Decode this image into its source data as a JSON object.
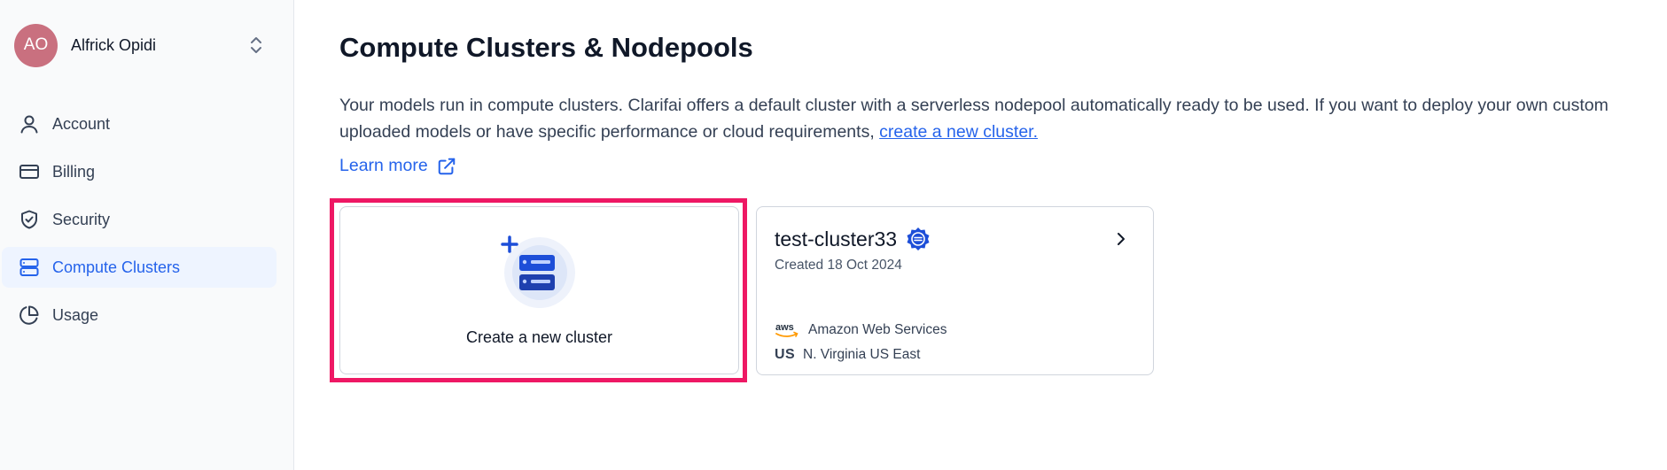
{
  "sidebar": {
    "user": {
      "initials": "AO",
      "name": "Alfrick Opidi",
      "avatar_color": "#c9707f"
    },
    "items": [
      {
        "label": "Account",
        "icon": "user-icon",
        "active": false
      },
      {
        "label": "Billing",
        "icon": "credit-card-icon",
        "active": false
      },
      {
        "label": "Security",
        "icon": "shield-check-icon",
        "active": false
      },
      {
        "label": "Compute Clusters",
        "icon": "server-icon",
        "active": true
      },
      {
        "label": "Usage",
        "icon": "pie-chart-icon",
        "active": false
      }
    ]
  },
  "main": {
    "title": "Compute Clusters & Nodepools",
    "description": "Your models run in compute clusters. Clarifai offers a default cluster with a serverless nodepool automatically ready to be used. If you want to deploy your own custom uploaded models or have specific performance or cloud requirements, ",
    "description_link": "create a new cluster.",
    "learn_more": "Learn more",
    "create_card": {
      "label": "Create a new cluster",
      "icon": "add-server-icon"
    },
    "clusters": [
      {
        "name": "test-cluster33",
        "created": "Created 18 Oct 2024",
        "provider_logo": "aws",
        "provider": "Amazon Web Services",
        "region_code": "US",
        "region": "N. Virginia US East"
      }
    ]
  },
  "colors": {
    "accent": "#2563eb",
    "highlight": "#ee1864",
    "active_bg": "#eef4ff"
  }
}
